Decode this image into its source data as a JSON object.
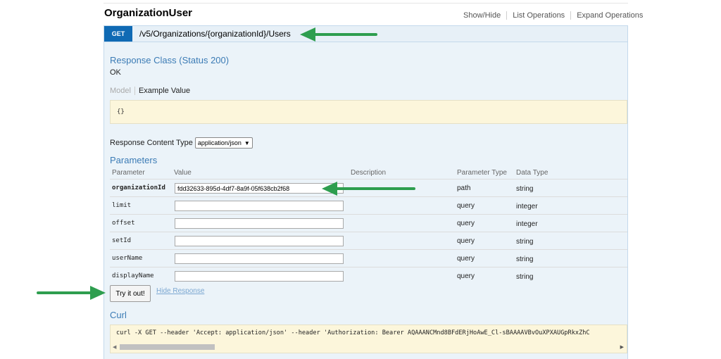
{
  "resource": {
    "title": "OrganizationUser",
    "links": [
      "Show/Hide",
      "List Operations",
      "Expand Operations"
    ]
  },
  "operation": {
    "method": "GET",
    "path": "/v5/Organizations/{organizationId}/Users"
  },
  "response_class": {
    "heading": "Response Class (Status 200)",
    "value": "OK",
    "tab_model": "Model",
    "tab_example": "Example Value",
    "example_value": "{}"
  },
  "content_type": {
    "label": "Response Content Type",
    "selected": "application/json"
  },
  "parameters": {
    "heading": "Parameters",
    "columns": [
      "Parameter",
      "Value",
      "Description",
      "Parameter Type",
      "Data Type"
    ],
    "rows": [
      {
        "name": "organizationId",
        "value": "fdd32633-895d-4df7-8a9f-05f638cb2f68",
        "param_type": "path",
        "data_type": "string",
        "required": true
      },
      {
        "name": "limit",
        "value": "",
        "param_type": "query",
        "data_type": "integer",
        "required": false
      },
      {
        "name": "offset",
        "value": "",
        "param_type": "query",
        "data_type": "integer",
        "required": false
      },
      {
        "name": "setId",
        "value": "",
        "param_type": "query",
        "data_type": "string",
        "required": false
      },
      {
        "name": "userName",
        "value": "",
        "param_type": "query",
        "data_type": "string",
        "required": false
      },
      {
        "name": "displayName",
        "value": "",
        "param_type": "query",
        "data_type": "string",
        "required": false
      }
    ]
  },
  "actions": {
    "try_label": "Try it out!",
    "hide_response_label": "Hide Response"
  },
  "curl": {
    "heading": "Curl",
    "command": "curl -X GET --header 'Accept: application/json' --header 'Authorization: Bearer AQAAANCMnd8BFdERjHoAwE_Cl-sBAAAAVBvOuXPXAUGpRkxZhC"
  },
  "colors": {
    "method_badge": "#0f6ab4",
    "section_heading": "#3b7bb5",
    "annotation_arrow": "#2e9e4f",
    "example_box": "#fcf6db"
  },
  "icons": {
    "select_chevron": "chevron-down-icon",
    "annotation": "arrow-icon"
  }
}
